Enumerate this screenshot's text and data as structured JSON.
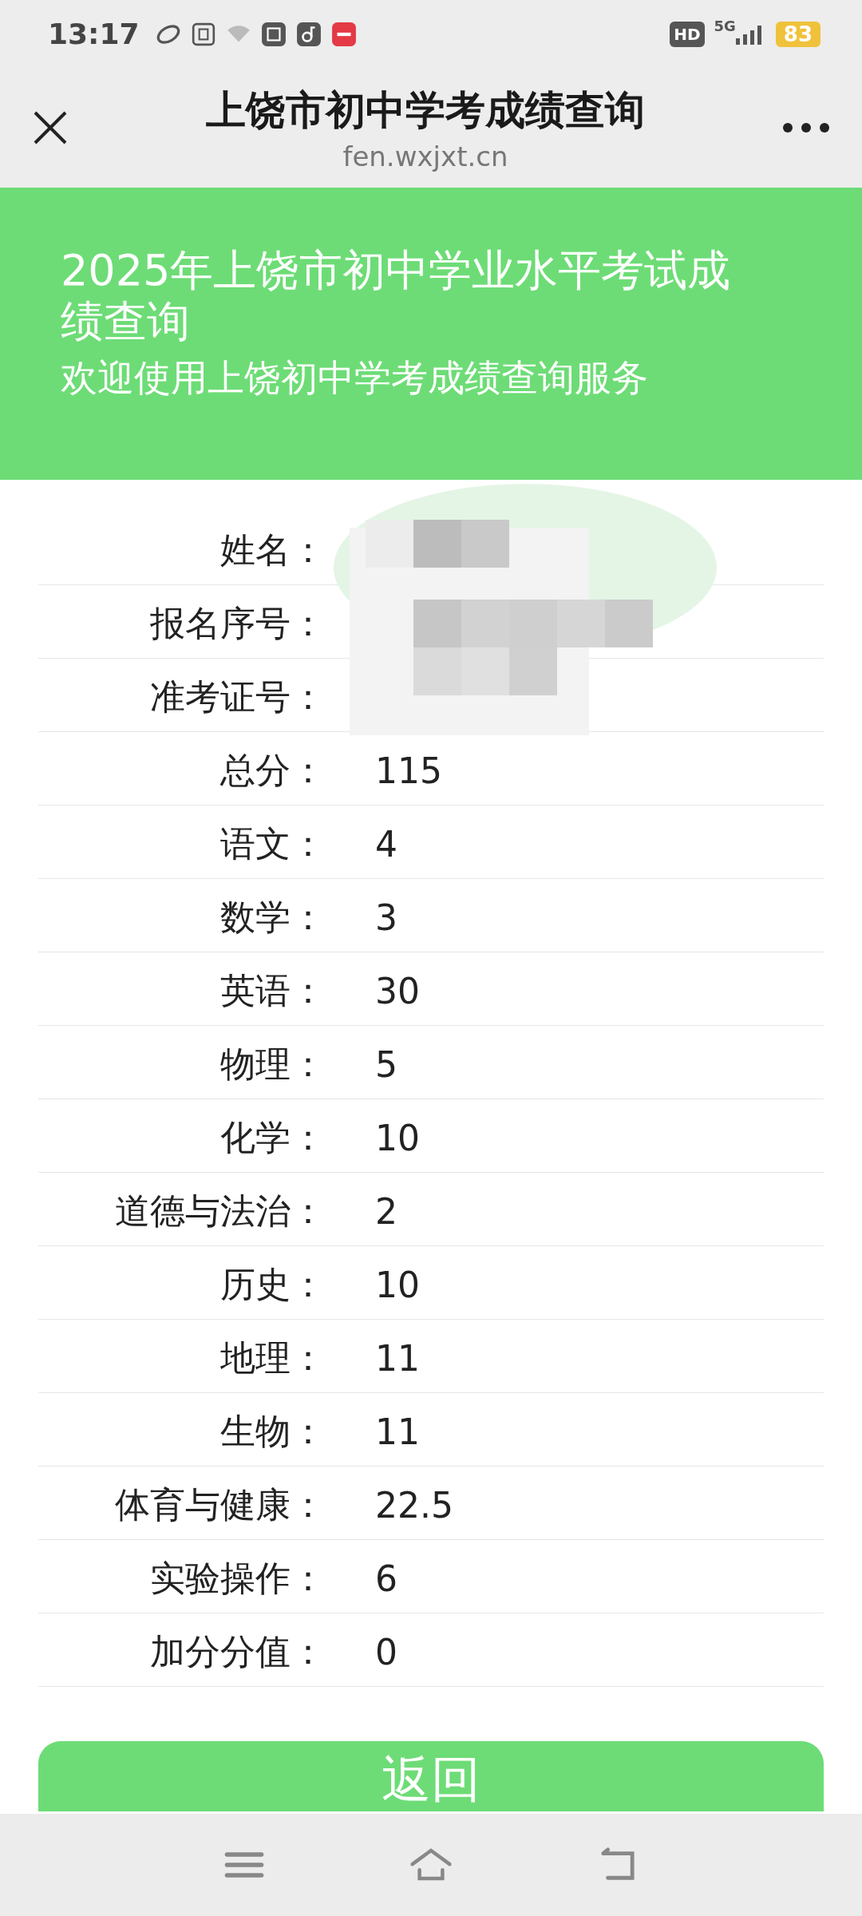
{
  "status_bar": {
    "time": "13:17",
    "battery": "83",
    "network": "5G",
    "badge": "HD"
  },
  "header": {
    "title": "上饶市初中学考成绩查询",
    "url": "fen.wxjxt.cn"
  },
  "banner": {
    "title": "2025年上饶市初中学业水平考试成绩查询",
    "subtitle": "欢迎使用上饶初中学考成绩查询服务"
  },
  "rows": [
    {
      "label": "姓名："
    },
    {
      "label": "报名序号："
    },
    {
      "label": "准考证号："
    },
    {
      "label": "总分：",
      "value": "115"
    },
    {
      "label": "语文：",
      "value": "4"
    },
    {
      "label": "数学：",
      "value": "3"
    },
    {
      "label": "英语：",
      "value": "30"
    },
    {
      "label": "物理：",
      "value": "5"
    },
    {
      "label": "化学：",
      "value": "10"
    },
    {
      "label": "道德与法治：",
      "value": "2"
    },
    {
      "label": "历史：",
      "value": "10"
    },
    {
      "label": "地理：",
      "value": "11"
    },
    {
      "label": "生物：",
      "value": "11"
    },
    {
      "label": "体育与健康：",
      "value": "22.5"
    },
    {
      "label": "实验操作：",
      "value": "6"
    },
    {
      "label": "加分分值：",
      "value": "0"
    }
  ],
  "button": "返回"
}
